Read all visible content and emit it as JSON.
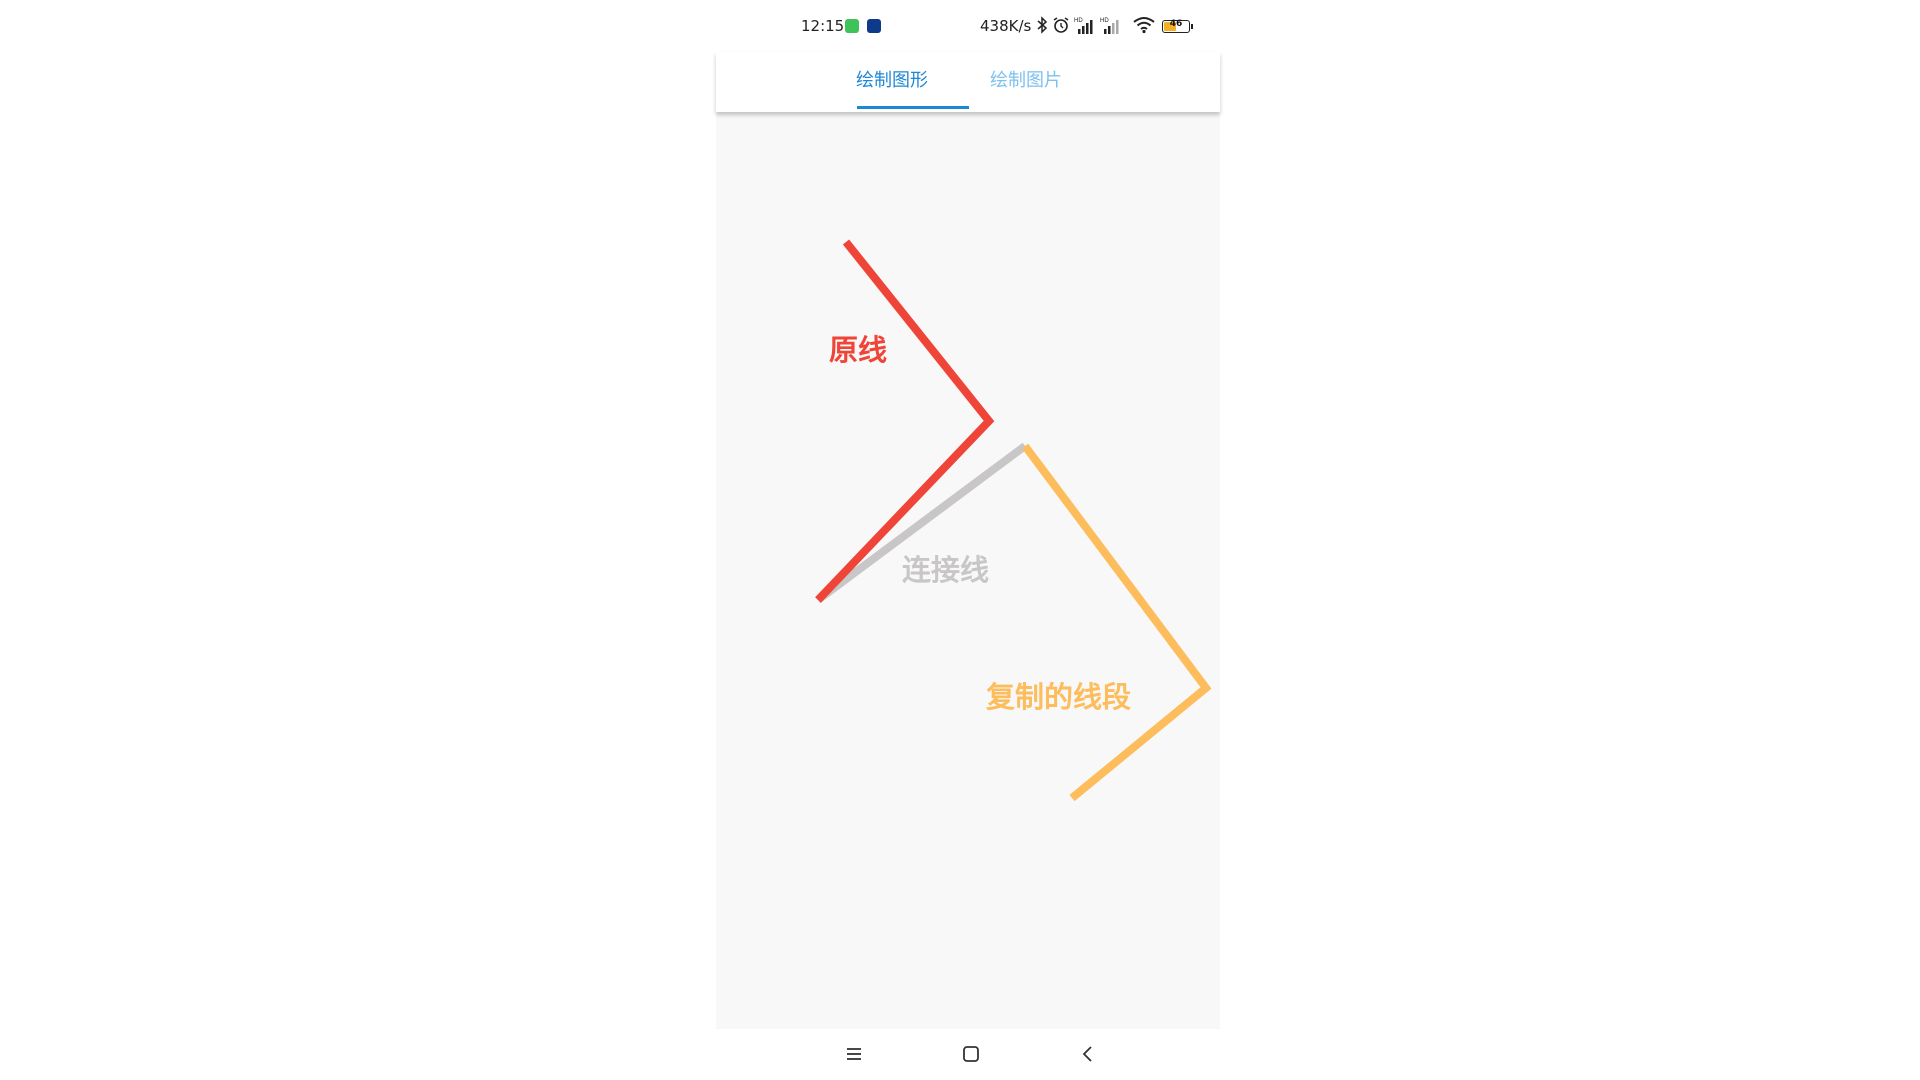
{
  "status_bar": {
    "time": "12:15",
    "net_speed": "438K/s",
    "battery_level": "46"
  },
  "tabs": [
    {
      "label": "绘制图形",
      "active": true
    },
    {
      "label": "绘制图片",
      "active": false
    }
  ],
  "canvas": {
    "labels": {
      "original": "原线",
      "connect": "连接线",
      "copied": "复制的线段"
    },
    "colors": {
      "original": "#ef4438",
      "connect": "#c8c6c6",
      "copied": "#fdbd5c",
      "background": "#f8f8f8"
    }
  },
  "nav_bar": {
    "buttons": [
      "menu",
      "home",
      "back"
    ]
  }
}
